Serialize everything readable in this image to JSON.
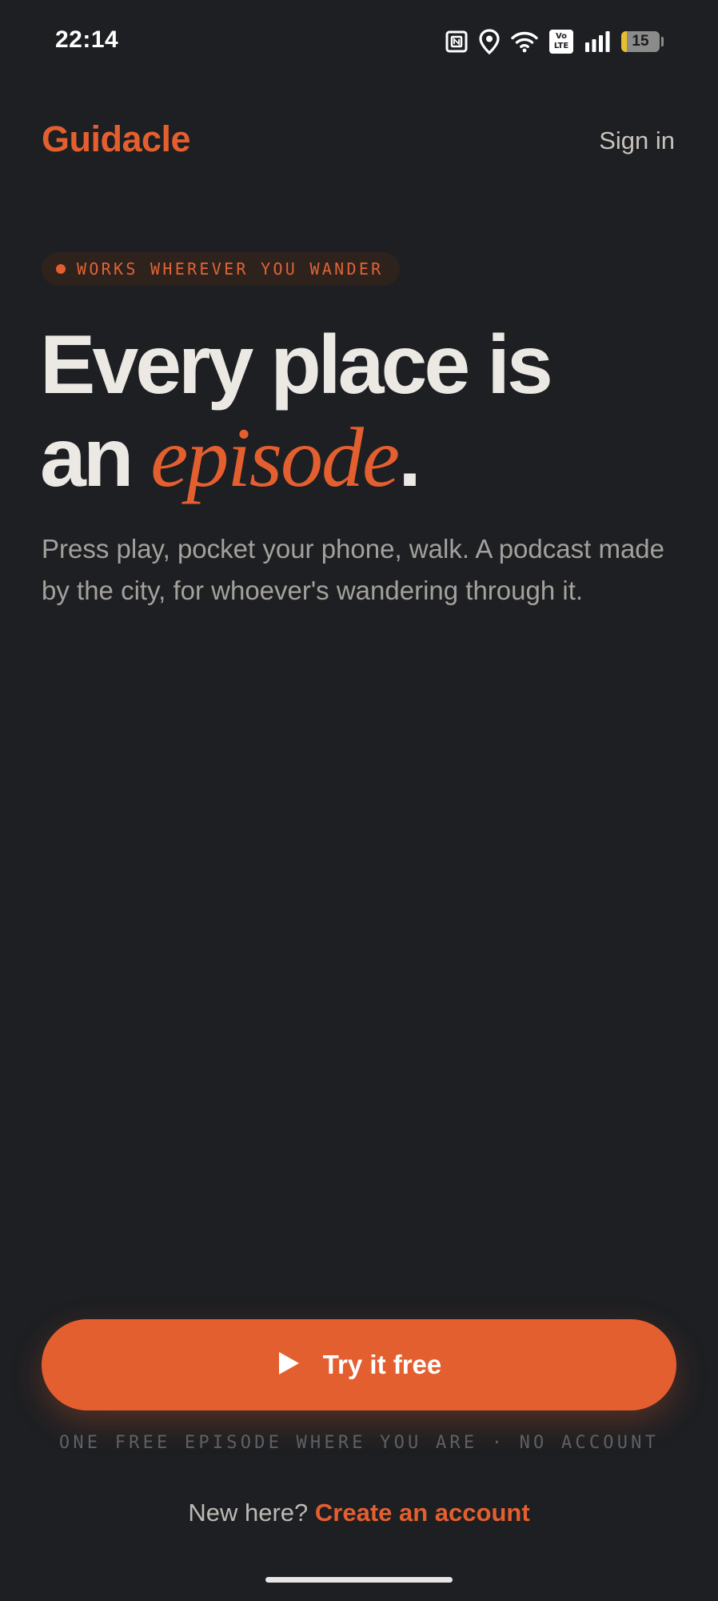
{
  "status_bar": {
    "time": "22:14",
    "volte_top": "Vo",
    "volte_bottom": "LTE",
    "battery_level": "15",
    "battery_fraction": 0.15,
    "icons": [
      "nfc-icon",
      "location-icon",
      "wifi-icon",
      "volte-icon",
      "signal-icon",
      "battery-icon"
    ]
  },
  "header": {
    "brand": "Guidacle",
    "sign_in": "Sign in"
  },
  "hero": {
    "tagline": "WORKS WHEREVER YOU WANDER",
    "headline_line1": "Every place is",
    "headline_line2_start": "an ",
    "headline_accent": "episode",
    "headline_end": ".",
    "intro": "Press play, pocket your phone, walk. A podcast made by the city, for whoever's wandering through it."
  },
  "cta": {
    "button_label": "Try it free",
    "button_icon": "play-icon",
    "note": "ONE FREE EPISODE WHERE YOU ARE · NO ACCOUNT",
    "signup_prompt": "New here?",
    "signup_link": "Create an account"
  },
  "colors": {
    "background": "#1d1f22",
    "accent": "#e45f2f",
    "text_primary": "#ece8e3",
    "text_muted": "#a4a19c"
  }
}
